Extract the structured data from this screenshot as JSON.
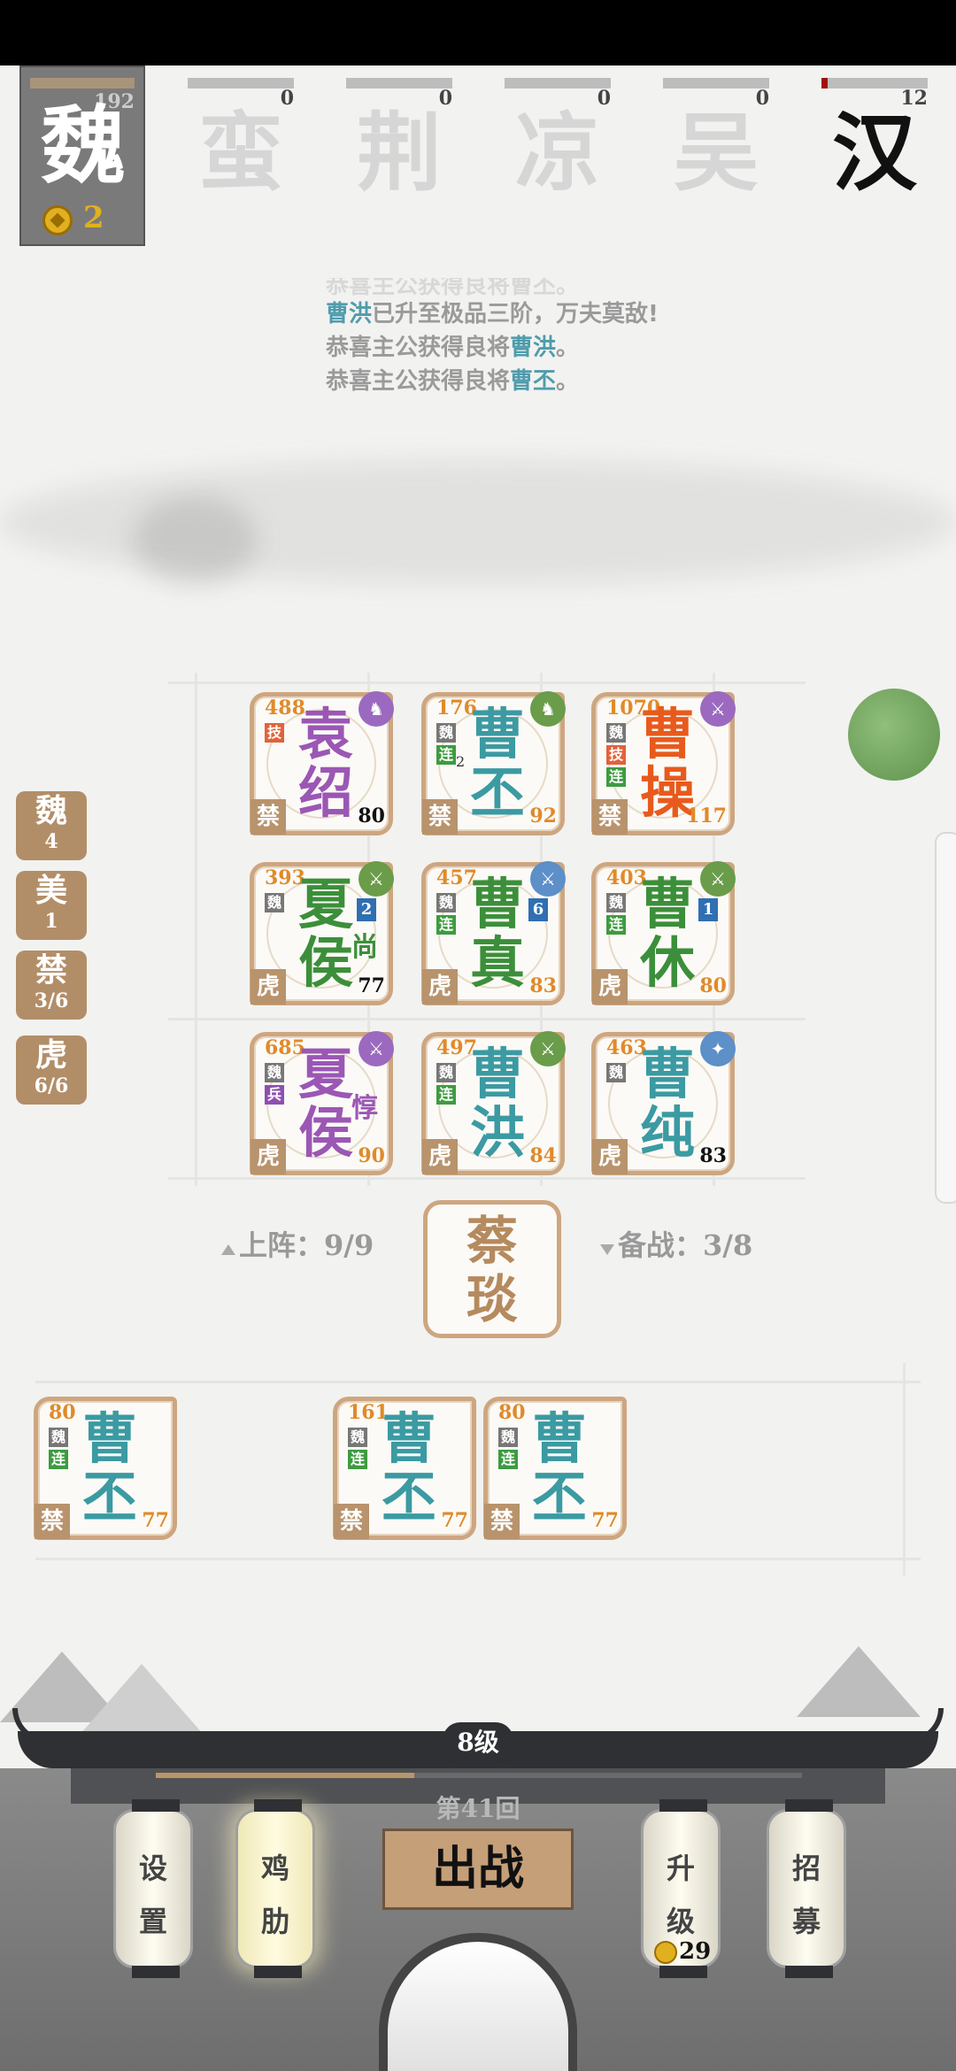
{
  "factions": {
    "active": {
      "name": "魏",
      "points": "192",
      "coins": "2"
    },
    "others": [
      {
        "name": "蛮",
        "points": "0",
        "progress": 0
      },
      {
        "name": "荆",
        "points": "0",
        "progress": 0
      },
      {
        "name": "凉",
        "points": "0",
        "progress": 0
      },
      {
        "name": "吴",
        "points": "0",
        "progress": 0
      },
      {
        "name": "汉",
        "points": "12",
        "progress": 0.06
      }
    ]
  },
  "news": {
    "line0": "恭喜主公获得良将曹丕。",
    "line1_name": "曹洪",
    "line1_text": "已升至极品三阶，万夫莫敌!",
    "line2_text": "恭喜主公获得良将",
    "line2_name": "曹洪",
    "line3_text": "恭喜主公获得良将",
    "line3_name": "曹丕",
    "end": "。"
  },
  "side_filters": [
    {
      "label": "魏",
      "value": "4"
    },
    {
      "label": "美",
      "value": "1"
    },
    {
      "label": "禁",
      "value": "3/6"
    },
    {
      "label": "虎",
      "value": "6/6"
    }
  ],
  "board": [
    {
      "level": "488",
      "name1": "袁",
      "name2": "绍",
      "power": "80",
      "position": "禁",
      "tags": [
        "技"
      ],
      "badge": "马",
      "color": "purple"
    },
    {
      "level": "176",
      "name1": "曹",
      "name2": "丕",
      "power": "92",
      "position": "禁",
      "tags": [
        "魏",
        "连"
      ],
      "badge": "马",
      "color": "teal",
      "sub": "2"
    },
    {
      "level": "1070",
      "name1": "曹",
      "name2": "操",
      "power": "117",
      "position": "禁",
      "tags": [
        "魏",
        "技",
        "连"
      ],
      "badge": "剑",
      "color": "orange"
    },
    {
      "level": "393",
      "name1": "夏",
      "name2": "侯",
      "power": "77",
      "position": "虎",
      "tags": [
        "魏"
      ],
      "badge": "剑",
      "color": "green",
      "num": "2",
      "extra": "尚"
    },
    {
      "level": "457",
      "name1": "曹",
      "name2": "真",
      "power": "83",
      "position": "虎",
      "tags": [
        "魏",
        "连"
      ],
      "badge": "剑",
      "color": "green",
      "num": "6"
    },
    {
      "level": "403",
      "name1": "曹",
      "name2": "休",
      "power": "80",
      "position": "虎",
      "tags": [
        "魏",
        "连"
      ],
      "badge": "剑",
      "color": "green",
      "num": "1"
    },
    {
      "level": "685",
      "name1": "夏",
      "name2": "侯",
      "power": "90",
      "position": "虎",
      "tags": [
        "魏",
        "兵"
      ],
      "badge": "剑",
      "color": "purple",
      "extra": "惇"
    },
    {
      "level": "497",
      "name1": "曹",
      "name2": "洪",
      "power": "84",
      "position": "虎",
      "tags": [
        "魏",
        "连"
      ],
      "badge": "剑",
      "color": "teal"
    },
    {
      "level": "463",
      "name1": "曹",
      "name2": "纯",
      "power": "83",
      "position": "虎",
      "tags": [
        "魏"
      ],
      "badge": "星",
      "color": "teal"
    }
  ],
  "deploy": {
    "label": "上阵：",
    "value": "9/9"
  },
  "reserve_count": {
    "label": "备战：",
    "value": "3/8"
  },
  "center_card": {
    "name1": "蔡",
    "name2": "琰"
  },
  "bench": [
    {
      "level": "80",
      "name1": "曹",
      "name2": "丕",
      "power": "77",
      "position": "禁",
      "tags": [
        "魏",
        "连"
      ]
    },
    {
      "level": "161",
      "name1": "曹",
      "name2": "丕",
      "power": "77",
      "position": "禁",
      "tags": [
        "魏",
        "连"
      ]
    },
    {
      "level": "80",
      "name1": "曹",
      "name2": "丕",
      "power": "77",
      "position": "禁",
      "tags": [
        "魏",
        "连"
      ]
    }
  ],
  "bottom": {
    "level": "8级",
    "level_progress": 0.4,
    "round": "第41回",
    "fight": "出战",
    "settings": [
      "设",
      "置"
    ],
    "chicken": [
      "鸡",
      "肋"
    ],
    "upgrade": [
      "升",
      "级"
    ],
    "upgrade_cost": "29",
    "recruit": [
      "招",
      "募"
    ]
  },
  "colors": {
    "purple": "#9b57b4",
    "teal": "#3b9aa2",
    "orange": "#e85a1c",
    "green": "#3c8f3a",
    "frame": "#cda680"
  }
}
